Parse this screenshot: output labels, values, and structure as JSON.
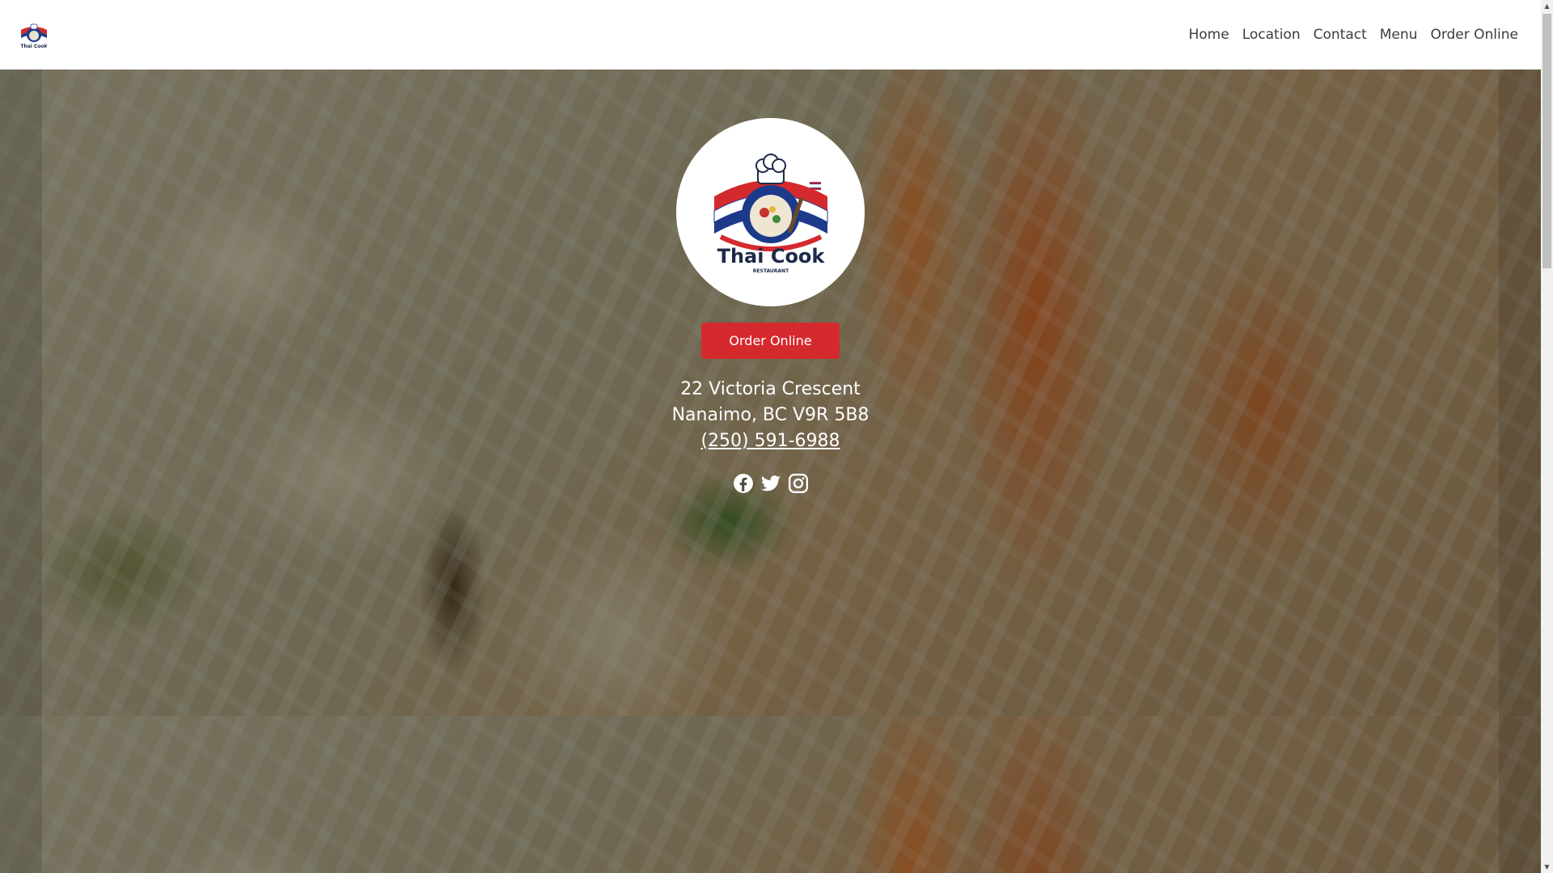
{
  "brand": {
    "logo_text": "Thai Cook",
    "logo_subtext": "RESTAURANT"
  },
  "nav": {
    "items": [
      {
        "label": "Home"
      },
      {
        "label": "Location"
      },
      {
        "label": "Contact"
      },
      {
        "label": "Menu"
      },
      {
        "label": "Order Online"
      }
    ]
  },
  "hero": {
    "order_button_label": "Order Online",
    "address_line1": "22 Victoria Crescent",
    "address_line2": "Nanaimo, BC V9R 5B8",
    "phone": "(250) 591-6988",
    "social_icons": [
      "facebook-icon",
      "twitter-icon",
      "instagram-icon"
    ]
  },
  "colors": {
    "accent": "#d42a2e",
    "nav_text": "#3c3c3c",
    "hero_text": "#ffffff",
    "logo_blue": "#1d3a8a",
    "logo_red": "#d42a2e"
  }
}
